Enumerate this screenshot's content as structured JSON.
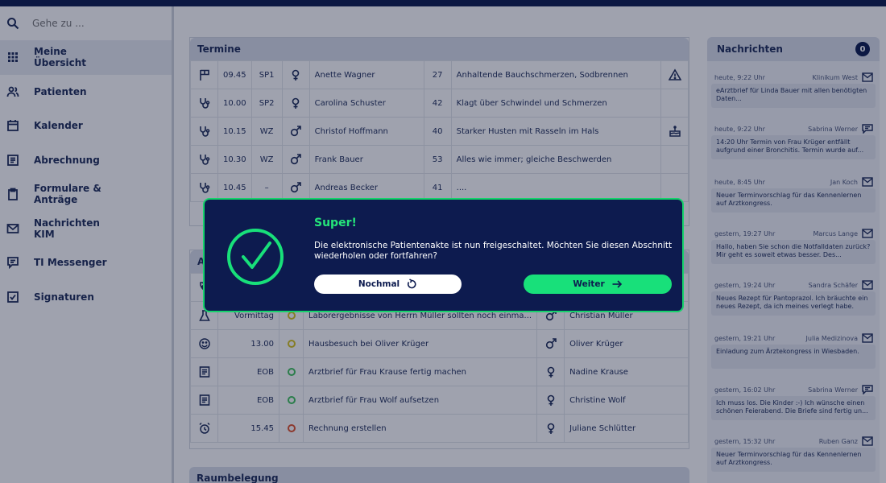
{
  "search": {
    "placeholder": "Gehe zu ..."
  },
  "sidebar": {
    "items": [
      {
        "label": "Meine Übersicht",
        "icon": "grid-icon"
      },
      {
        "label": "Patienten",
        "icon": "users-icon"
      },
      {
        "label": "Kalender",
        "icon": "calendar-icon"
      },
      {
        "label": "Abrechnung",
        "icon": "billing-icon"
      },
      {
        "label": "Formulare & Anträge",
        "icon": "clipboard-icon"
      },
      {
        "label": "Nachrichten KIM",
        "icon": "mail-icon"
      },
      {
        "label": "TI Messenger",
        "icon": "chat-icon"
      },
      {
        "label": "Signaturen",
        "icon": "checkbox-icon"
      }
    ]
  },
  "termine": {
    "title": "Termine",
    "rows": [
      {
        "icon": "flag-icon",
        "time": "09.45",
        "room": "SP1",
        "gender": "female-icon",
        "name": "Anette Wagner",
        "age": "27",
        "reason": "Anhaltende Bauchschmerzen, Sodbrennen",
        "status": "warning-icon"
      },
      {
        "icon": "stethoscope-icon",
        "time": "10.00",
        "room": "SP2",
        "gender": "female-icon",
        "name": "Carolina Schuster",
        "age": "42",
        "reason": "Klagt über Schwindel und Schmerzen",
        "status": ""
      },
      {
        "icon": "stethoscope-icon",
        "time": "10.15",
        "room": "WZ",
        "gender": "male-icon",
        "name": "Christof Hoffmann",
        "age": "40",
        "reason": "Starker Husten mit Rasseln im Hals",
        "status": "cake-icon"
      },
      {
        "icon": "stethoscope-icon",
        "time": "10.30",
        "room": "WZ",
        "gender": "male-icon",
        "name": "Frank Bauer",
        "age": "53",
        "reason": "Alles wie immer; gleiche Beschwerden",
        "status": ""
      },
      {
        "icon": "stethoscope-icon",
        "time": "10.45",
        "room": "–",
        "gender": "male-icon",
        "name": "Andreas Becker",
        "age": "41",
        "reason": "....",
        "status": ""
      }
    ]
  },
  "aufgaben": {
    "title": "A",
    "rows": [
      {
        "icon": "flask-icon",
        "time": "Vormittag",
        "dot": "#d5c21c",
        "task": "Laborergebnisse von Herrn Müller sollten noch einma...",
        "gender": "male-icon",
        "person": "Christian Müller"
      },
      {
        "icon": "smiley-icon",
        "time": "13.00",
        "dot": "#d5c21c",
        "task": "Hausbesuch bei Oliver Krüger",
        "gender": "male-icon",
        "person": "Oliver Krüger"
      },
      {
        "icon": "document-icon",
        "time": "EOB",
        "dot": "#3fc25a",
        "task": "Arztbrief für Frau Krause fertig machen",
        "gender": "female-icon",
        "person": "Nadine Krause"
      },
      {
        "icon": "document-icon",
        "time": "EOB",
        "dot": "#3fc25a",
        "task": "Arztbrief für Frau Wolf aufsetzen",
        "gender": "female-icon",
        "person": "Christine Wolf"
      },
      {
        "icon": "alarm-icon",
        "time": "15.45",
        "dot": "#e0502a",
        "task": "Rechnung erstellen",
        "gender": "female-icon",
        "person": "Juliane Schlütter"
      }
    ]
  },
  "raum": {
    "title": "Raumbelegung"
  },
  "messages": {
    "title": "Nachrichten",
    "count": "0",
    "items": [
      {
        "time": "heute, 9:22 Uhr",
        "from": "Klinikum West",
        "kind": "mail-icon",
        "text": "eArztbrief für Linda Bauer mit allen benötigten Daten..."
      },
      {
        "time": "heute, 9:22 Uhr",
        "from": "Sabrina Werner",
        "kind": "chat-icon",
        "text": "14:20 Uhr Termin von Frau Krüger entfällt aufgrund einer Bronchitis. Termin wurde auf..."
      },
      {
        "time": "heute, 8:45 Uhr",
        "from": "Jan Koch",
        "kind": "mail-icon",
        "text": "Neuer Terminvorschlag für das Kennenlernen auf Arztkongress."
      },
      {
        "time": "gestern, 19:27 Uhr",
        "from": "Marcus Lange",
        "kind": "mail-icon",
        "text": "Hallo, haben Sie schon die Notfalldaten zurück? Mir geht es soweit etwas besser. Des..."
      },
      {
        "time": "gestern, 19:24 Uhr",
        "from": "Sandra Schäfer",
        "kind": "mail-icon",
        "text": "Neues Rezept für Pantoprazol. Ich bräuchte ein neues Rezept, da ich meines verlegt habe."
      },
      {
        "time": "gestern, 19:21 Uhr",
        "from": "Julia Medizinova",
        "kind": "mail-icon",
        "text": "Einladung zum Ärztekongress in Wiesbaden."
      },
      {
        "time": "gestern, 16:02 Uhr",
        "from": "Sabrina Werner",
        "kind": "chat-icon",
        "text": "Ich muss los. Die Kinder :-) Ich wünsche einen schönen Feierabend. Die Briefe sind fertig un..."
      },
      {
        "time": "gestern, 15:32 Uhr",
        "from": "Ruben Ganz",
        "kind": "mail-icon",
        "text": "Neuer Terminvorschlag für das Kennenlernen auf Arztkongress."
      }
    ]
  },
  "dialog": {
    "title": "Super!",
    "text": "Die elektronische Patientenakte ist nun freigeschaltet. Möchten Sie diesen Abschnitt wiederholen oder fortfahren?",
    "again_label": "Nochmal",
    "next_label": "Weiter",
    "accent": "#18e07a"
  }
}
